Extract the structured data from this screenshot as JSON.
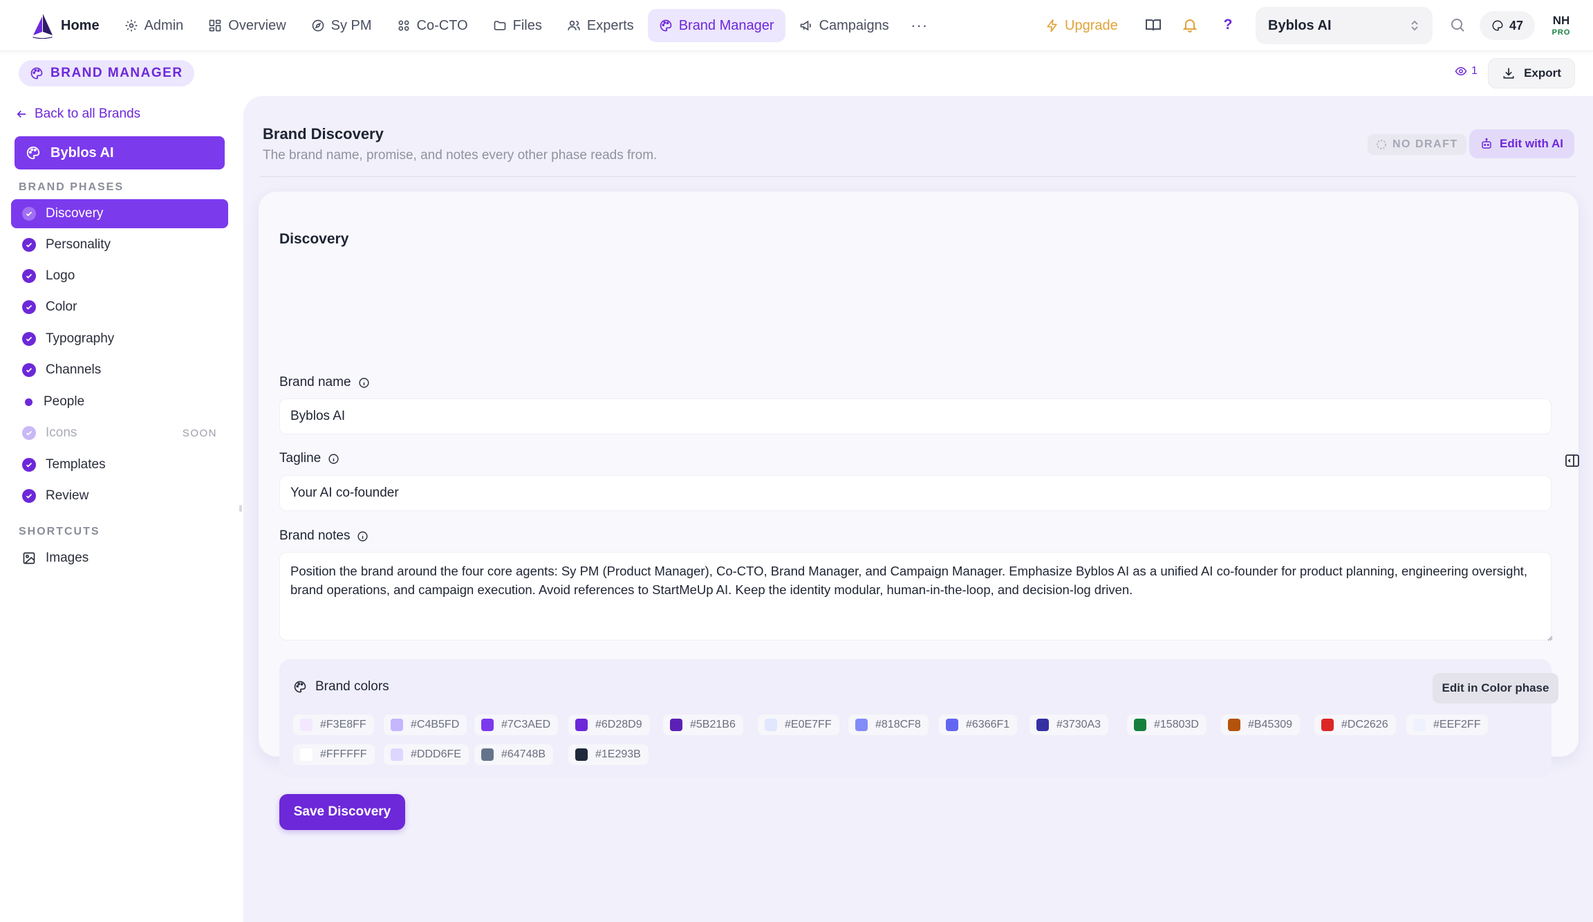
{
  "nav": {
    "items": [
      {
        "label": "Home",
        "icon": "logo",
        "active": false
      },
      {
        "label": "Admin",
        "icon": "gear-icon",
        "active": false
      },
      {
        "label": "Overview",
        "icon": "grid-icon",
        "active": false
      },
      {
        "label": "Sy PM",
        "icon": "compass-icon",
        "active": false
      },
      {
        "label": "Co-CTO",
        "icon": "nodes-icon",
        "active": false
      },
      {
        "label": "Files",
        "icon": "folder-icon",
        "active": false
      },
      {
        "label": "Experts",
        "icon": "users-icon",
        "active": false
      },
      {
        "label": "Brand Manager",
        "icon": "palette-icon",
        "active": true
      },
      {
        "label": "Campaigns",
        "icon": "megaphone-icon",
        "active": false
      }
    ],
    "more_label": "···",
    "upgrade_label": "Upgrade",
    "help_label": "?",
    "brand_select_value": "Byblos AI",
    "credits": "47",
    "user_initials": "NH",
    "user_plan": "PRO"
  },
  "subheader": {
    "module_label": "BRAND MANAGER",
    "views_count": "1",
    "export_label": "Export"
  },
  "sidebar": {
    "back_label": "Back to all Brands",
    "current_brand": "Byblos AI",
    "phases_heading": "BRAND PHASES",
    "phases": [
      {
        "label": "Discovery",
        "state": "active"
      },
      {
        "label": "Personality",
        "state": "done"
      },
      {
        "label": "Logo",
        "state": "done"
      },
      {
        "label": "Color",
        "state": "done"
      },
      {
        "label": "Typography",
        "state": "done"
      },
      {
        "label": "Channels",
        "state": "done"
      },
      {
        "label": "People",
        "state": "in-progress"
      },
      {
        "label": "Icons",
        "state": "disabled",
        "badge": "SOON"
      },
      {
        "label": "Templates",
        "state": "done"
      },
      {
        "label": "Review",
        "state": "done"
      }
    ],
    "shortcuts_heading": "SHORTCUTS",
    "shortcuts": [
      {
        "label": "Images",
        "icon": "image-icon"
      }
    ]
  },
  "main": {
    "title": "Brand Discovery",
    "subtitle": "The brand name, promise, and notes every other phase reads from.",
    "draft_status": "NO DRAFT",
    "edit_ai_label": "Edit with AI",
    "card": {
      "title": "Discovery",
      "brand_name_label": "Brand name",
      "brand_name_value": "Byblos AI",
      "tagline_label": "Tagline",
      "tagline_value": "Your AI co-founder",
      "notes_label": "Brand notes",
      "notes_value": "Position the brand around the four core agents: Sy PM (Product Manager), Co-CTO, Brand Manager, and Campaign Manager. Emphasize Byblos AI as a unified AI co-founder for product planning, engineering oversight, brand operations, and campaign execution. Avoid references to StartMeUp AI. Keep the identity modular, human-in-the-loop, and decision-log driven.",
      "colors_label": "Brand colors",
      "edit_color_label": "Edit in Color phase",
      "colors": [
        {
          "hex": "#F3E8FF"
        },
        {
          "hex": "#C4B5FD"
        },
        {
          "hex": "#7C3AED"
        },
        {
          "hex": "#6D28D9"
        },
        {
          "hex": "#5B21B6"
        },
        {
          "hex": "#E0E7FF"
        },
        {
          "hex": "#818CF8"
        },
        {
          "hex": "#6366F1"
        },
        {
          "hex": "#3730A3"
        },
        {
          "hex": "#15803D"
        },
        {
          "hex": "#B45309"
        },
        {
          "hex": "#DC2626"
        },
        {
          "hex": "#EEF2FF"
        },
        {
          "hex": "#FFFFFF"
        },
        {
          "hex": "#DDD6FE"
        },
        {
          "hex": "#64748B"
        },
        {
          "hex": "#1E293B"
        }
      ],
      "save_label": "Save Discovery"
    }
  },
  "theme": {
    "accent": "#7C3AED",
    "accent_dark": "#6D28D9",
    "upgrade": "#E1A33A",
    "pro": "#15803D"
  }
}
